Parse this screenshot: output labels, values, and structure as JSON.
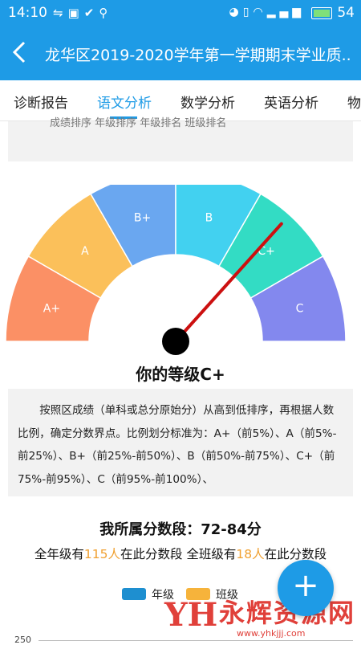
{
  "status_bar": {
    "time": "14:10",
    "battery": "54",
    "left_icons": [
      "usb-icon",
      "image-icon",
      "check-icon",
      "share-icon"
    ],
    "right_icons": [
      "alarm-icon",
      "vibrate-icon",
      "wifi-icon",
      "signal-icon",
      "battery-icon"
    ]
  },
  "app_bar": {
    "title": "龙华区2019-2020学年第一学期期末学业质..",
    "back_icon": "back-arrow-icon"
  },
  "tabs": [
    "诊断报告",
    "语文分析",
    "数学分析",
    "英语分析",
    "物"
  ],
  "active_tab": 1,
  "prev_section_cut_text": "成绩排序    年级排序    年级排名    班级排名",
  "gauge": {
    "segments": [
      {
        "label": "A+",
        "color": "#fb9065"
      },
      {
        "label": "A",
        "color": "#fbc05a"
      },
      {
        "label": "B+",
        "color": "#6aa7f0"
      },
      {
        "label": "B",
        "color": "#42d1f0"
      },
      {
        "label": "C+",
        "color": "#33dcc4"
      },
      {
        "label": "C",
        "color": "#8388ee"
      }
    ],
    "needle_grade": "C+",
    "needle_color": "#cc1010"
  },
  "grade_text": "你的等级C+",
  "description": [
    "按照区成绩（单科或总分原始分）从高到低排序，再根据人数比例，确定分数界点。比例划分标准为：A+（前5%）、A（前5%-前25%）、B+（前25%-前50%）、B（前50%-前75%）、C+（前75%-前95%）、C（前95%-前100%）、"
  ],
  "segment": {
    "title": "我所属分数段：72-84分",
    "p1": "全年级有",
    "grade_count": "115人",
    "p2": "在此分数段 全班级有",
    "class_count": "18人",
    "p3": "在此分数段"
  },
  "legend": [
    {
      "label": "年级",
      "color": "#1e8fd0"
    },
    {
      "label": "班级",
      "color": "#f6b33b"
    }
  ],
  "axis_tick": "250",
  "fab_symbol": "+",
  "watermark": {
    "logo": "YH",
    "name": "永辉资源网",
    "url": "www.yhkjjj.com"
  }
}
